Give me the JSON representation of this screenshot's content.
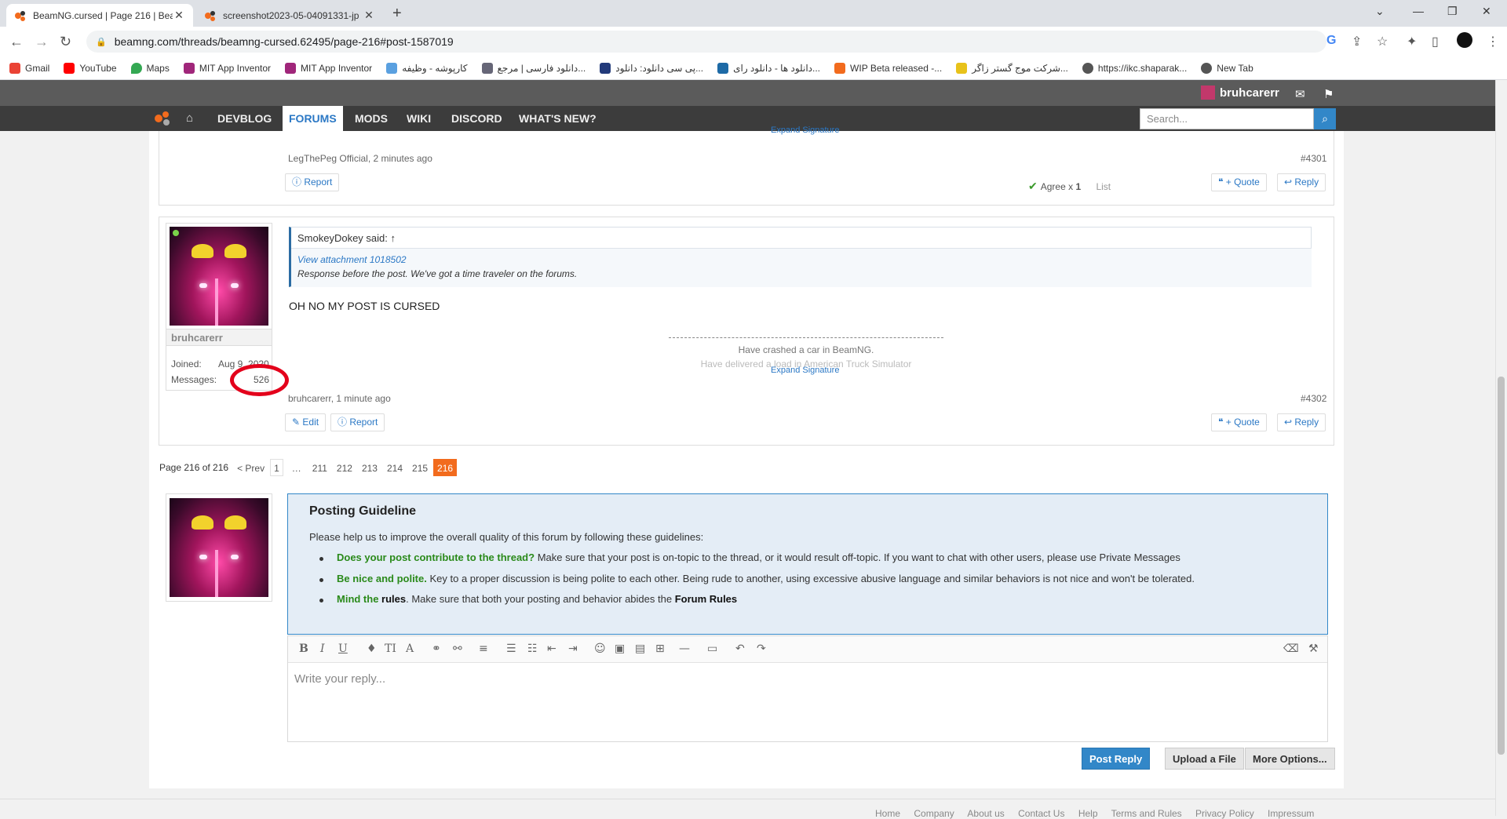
{
  "browser": {
    "tabs": [
      {
        "title": "BeamNG.cursed | Page 216 | Bea",
        "active": true
      },
      {
        "title": "screenshot2023-05-04091331-jp",
        "active": false
      }
    ],
    "url": "beamng.com/threads/beamng-cursed.62495/page-216#post-1587019",
    "bookmarks": [
      "Gmail",
      "YouTube",
      "Maps",
      "MIT App Inventor",
      "MIT App Inventor",
      "کارپوشه - وظیفه",
      "دانلود فارسی | مرجع...",
      "پی سی دانلود: دانلود...",
      "دانلود ها - دانلود رای...",
      "WIP Beta released -...",
      "شرکت موج گستر زاگر...",
      "https://ikc.shaparak...",
      "New Tab"
    ]
  },
  "site": {
    "username": "bruhcarerr",
    "nav": [
      "DEVBLOG",
      "FORUMS",
      "MODS",
      "WIKI",
      "DISCORD",
      "WHAT'S NEW?"
    ],
    "search_placeholder": "Search..."
  },
  "post1": {
    "expand_signature": "Expand Signature",
    "meta": "LegThePeg Official, 2 minutes ago",
    "number": "#4301",
    "report": "Report",
    "likes_label": "Agree x",
    "likes_count": "1",
    "list": "List",
    "quote": "+ Quote",
    "reply": "Reply"
  },
  "post2": {
    "username": "bruhcarerr",
    "joined_label": "Joined:",
    "joined_value": "Aug 9, 2020",
    "messages_label": "Messages:",
    "messages_value": "526",
    "quote_author": "SmokeyDokey said: ↑",
    "quote_attachment": "View attachment 1018502",
    "quote_text": "Response before the post. We've got a time traveler on the forums.",
    "body": "OH NO MY POST IS CURSED",
    "sig_line1": "Have crashed a car in BeamNG.",
    "sig_line2": "Have delivered a load in American Truck Simulator",
    "expand_signature": "Expand Signature",
    "meta": "bruhcarerr, 1 minute ago",
    "number": "#4302",
    "edit": "Edit",
    "report": "Report",
    "quote": "+ Quote",
    "reply": "Reply"
  },
  "pagination": {
    "label": "Page 216 of 216",
    "prev": "< Prev",
    "pages": [
      "1",
      "211",
      "212",
      "213",
      "214",
      "215",
      "216"
    ],
    "ellipsis": "…"
  },
  "guideline": {
    "title": "Posting Guideline",
    "intro": "Please help us to improve the overall quality of this forum by following these guidelines:",
    "r1_bold": "Does your post contribute to the thread?",
    "r1_text": " Make sure that your post is on-topic to the thread, or it would result off-topic. If you want to chat with other users, please use Private Messages",
    "r2_bold": "Be nice and polite.",
    "r2_text": " Key to a proper discussion is being polite to each other. Being rude to another, using excessive abusive language and similar behaviors is not nice and won't be tolerated.",
    "r3_green": "Mind the",
    "r3_black": " rules",
    "r3_text": ". Make sure that both your posting and behavior abides the ",
    "r3_link": "Forum Rules"
  },
  "editor": {
    "placeholder": "Write your reply...",
    "post_reply": "Post Reply",
    "upload": "Upload a File",
    "more": "More Options..."
  },
  "footer": [
    "Home",
    "Company",
    "About us",
    "Contact Us",
    "Help",
    "Terms and Rules",
    "Privacy Policy",
    "Impressum"
  ],
  "colors": {
    "accent": "#3287c8",
    "current_page": "#f26b1d",
    "highlight_ring": "#e3001b"
  }
}
